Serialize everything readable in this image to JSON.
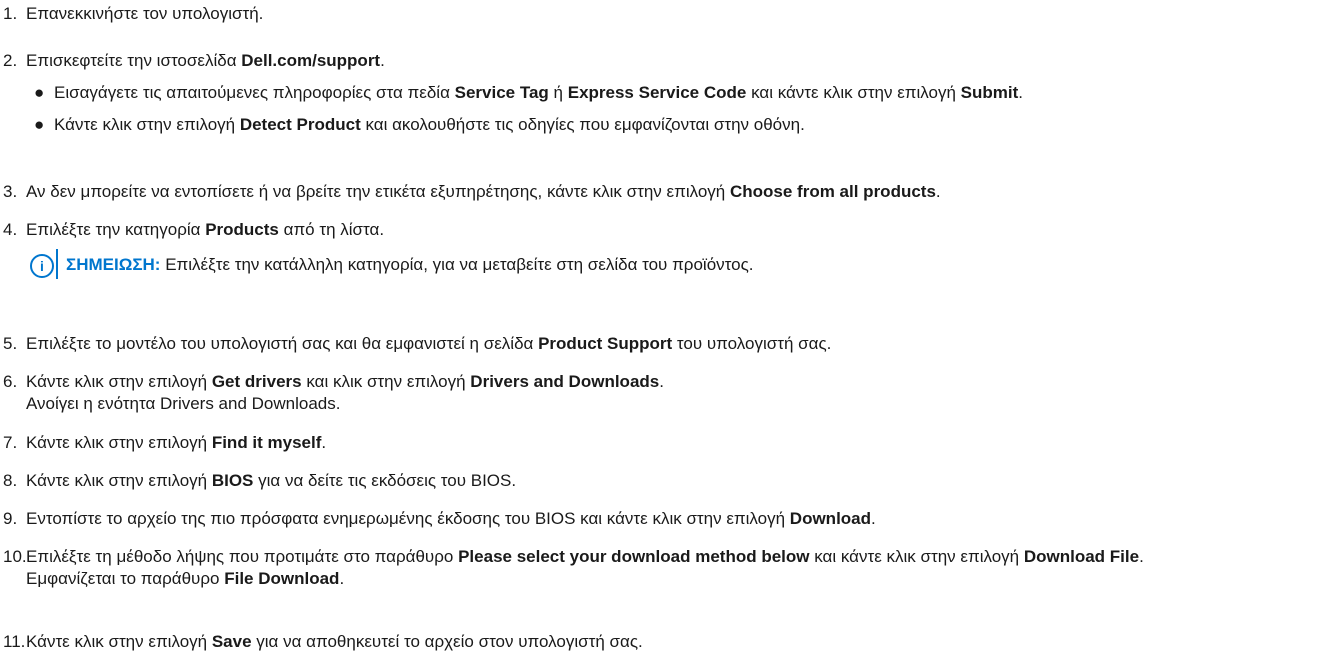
{
  "steps": [
    {
      "number": "1.",
      "parts": [
        {
          "t": "Επανεκκινήστε τον υπολογιστή."
        }
      ]
    },
    {
      "number": "2.",
      "parts": [
        {
          "t": "Επισκεφτείτε την ιστοσελίδα "
        },
        {
          "t": "Dell.com/support",
          "b": true
        },
        {
          "t": "."
        }
      ],
      "bullets": [
        [
          {
            "t": "Εισαγάγετε τις απαιτούμενες πληροφορίες στα πεδία "
          },
          {
            "t": "Service Tag",
            "b": true
          },
          {
            "t": " ή "
          },
          {
            "t": "Express Service Code",
            "b": true
          },
          {
            "t": " και κάντε κλικ στην επιλογή "
          },
          {
            "t": "Submit",
            "b": true
          },
          {
            "t": "."
          }
        ],
        [
          {
            "t": "Κάντε κλικ στην επιλογή "
          },
          {
            "t": "Detect Product",
            "b": true
          },
          {
            "t": " και ακολουθήστε τις οδηγίες που εμφανίζονται στην οθόνη."
          }
        ]
      ]
    },
    {
      "number": "3.",
      "parts": [
        {
          "t": "Αν δεν μπορείτε να εντοπίσετε ή να βρείτε την ετικέτα εξυπηρέτησης, κάντε κλικ στην επιλογή "
        },
        {
          "t": "Choose from all products",
          "b": true
        },
        {
          "t": "."
        }
      ]
    },
    {
      "number": "4.",
      "parts": [
        {
          "t": "Επιλέξτε την κατηγορία "
        },
        {
          "t": "Products",
          "b": true
        },
        {
          "t": " από τη λίστα."
        }
      ],
      "note": {
        "icon": "info-icon",
        "label": "ΣΗΜΕΙΩΣΗ:",
        "text": " Επιλέξτε την κατάλληλη κατηγορία, για να μεταβείτε στη σελίδα του προϊόντος."
      }
    },
    {
      "number": "5.",
      "parts": [
        {
          "t": "Επιλέξτε το μοντέλο του υπολογιστή σας και θα εμφανιστεί η σελίδα "
        },
        {
          "t": "Product Support",
          "b": true
        },
        {
          "t": " του υπολογιστή σας."
        }
      ]
    },
    {
      "number": "6.",
      "parts": [
        {
          "t": "Κάντε κλικ στην επιλογή "
        },
        {
          "t": "Get drivers",
          "b": true
        },
        {
          "t": " και κλικ στην επιλογή "
        },
        {
          "t": "Drivers and Downloads",
          "b": true
        },
        {
          "t": "."
        },
        {
          "br": true
        },
        {
          "t": "Ανοίγει η ενότητα Drivers and Downloads."
        }
      ]
    },
    {
      "number": "7.",
      "parts": [
        {
          "t": "Κάντε κλικ στην επιλογή "
        },
        {
          "t": "Find it myself",
          "b": true
        },
        {
          "t": "."
        }
      ]
    },
    {
      "number": "8.",
      "parts": [
        {
          "t": "Κάντε κλικ στην επιλογή "
        },
        {
          "t": "BIOS",
          "b": true
        },
        {
          "t": " για να δείτε τις εκδόσεις του BIOS."
        }
      ]
    },
    {
      "number": "9.",
      "parts": [
        {
          "t": "Εντοπίστε το αρχείο της πιο πρόσφατα ενημερωμένης έκδοσης του BIOS και κάντε κλικ στην επιλογή "
        },
        {
          "t": "Download",
          "b": true
        },
        {
          "t": "."
        }
      ]
    },
    {
      "number": "10.",
      "parts": [
        {
          "t": "Επιλέξτε τη μέθοδο λήψης που προτιμάτε στο παράθυρο "
        },
        {
          "t": "Please select your download method below",
          "b": true
        },
        {
          "t": " και κάντε κλικ στην επιλογή "
        },
        {
          "t": "Download File",
          "b": true
        },
        {
          "t": "."
        },
        {
          "br": true
        },
        {
          "t": "Εμφανίζεται το παράθυρο "
        },
        {
          "t": "File Download",
          "b": true
        },
        {
          "t": "."
        }
      ]
    },
    {
      "number": "11.",
      "parts": [
        {
          "t": "Κάντε κλικ στην επιλογή "
        },
        {
          "t": "Save",
          "b": true
        },
        {
          "t": " για να αποθηκευτεί το αρχείο στον υπολογιστή σας."
        }
      ]
    }
  ]
}
